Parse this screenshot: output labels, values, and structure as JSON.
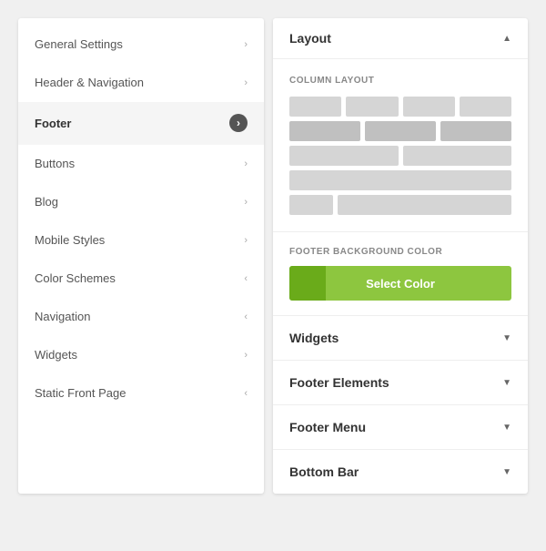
{
  "sidebar": {
    "items": [
      {
        "id": "general-settings",
        "label": "General Settings",
        "active": false
      },
      {
        "id": "header-navigation",
        "label": "Header & Navigation",
        "active": false
      },
      {
        "id": "footer",
        "label": "Footer",
        "active": true
      },
      {
        "id": "buttons",
        "label": "Buttons",
        "active": false
      },
      {
        "id": "blog",
        "label": "Blog",
        "active": false
      },
      {
        "id": "mobile-styles",
        "label": "Mobile Styles",
        "active": false
      },
      {
        "id": "color-schemes",
        "label": "Color Schemes",
        "active": false
      },
      {
        "id": "navigation",
        "label": "Navigation",
        "active": false
      },
      {
        "id": "widgets",
        "label": "Widgets",
        "active": false
      },
      {
        "id": "static-front-page",
        "label": "Static Front Page",
        "active": false
      }
    ]
  },
  "rightPanel": {
    "layout": {
      "title": "Layout",
      "sectionLabel": "COLUMN LAYOUT",
      "footerBgLabel": "FOOTER BACKGROUND COLOR",
      "selectColorLabel": "Select Color"
    },
    "accordions": [
      {
        "id": "widgets",
        "title": "Widgets"
      },
      {
        "id": "footer-elements",
        "title": "Footer Elements"
      },
      {
        "id": "footer-menu",
        "title": "Footer Menu"
      },
      {
        "id": "bottom-bar",
        "title": "Bottom Bar"
      }
    ]
  }
}
